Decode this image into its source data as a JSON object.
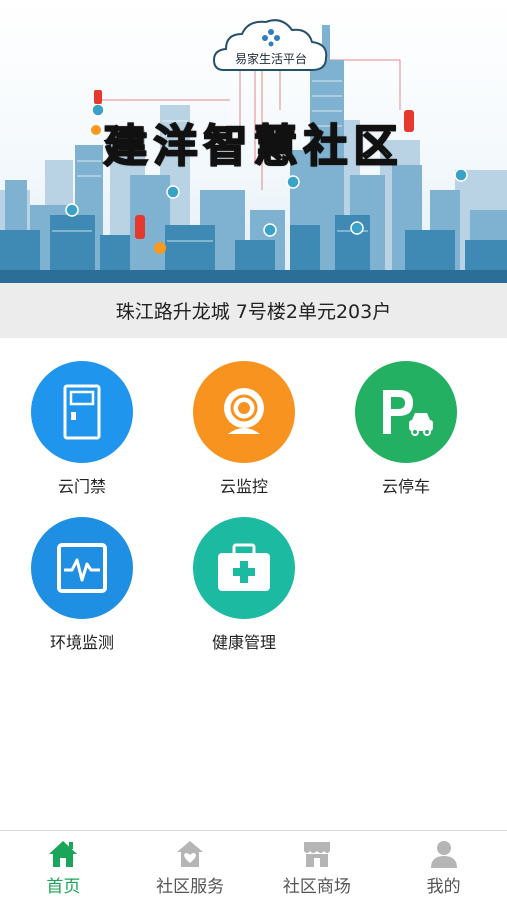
{
  "banner": {
    "cloud_label": "易家生活平台",
    "title": "建洋智慧社区"
  },
  "address": "珠江路升龙城 7号楼2单元203户",
  "services": [
    {
      "label": "云门禁",
      "icon": "door-icon",
      "color": "#1f95ee"
    },
    {
      "label": "云监控",
      "icon": "camera-icon",
      "color": "#f7931e"
    },
    {
      "label": "云停车",
      "icon": "parking-icon",
      "color": "#23b062"
    },
    {
      "label": "环境监测",
      "icon": "monitor-icon",
      "color": "#1f8fe3"
    },
    {
      "label": "健康管理",
      "icon": "medkit-icon",
      "color": "#1cbaa0"
    }
  ],
  "bottom_nav": {
    "active_color": "#1aa55a",
    "items": [
      {
        "label": "首页",
        "icon": "home-icon",
        "active": true
      },
      {
        "label": "社区服务",
        "icon": "community-service-icon",
        "active": false
      },
      {
        "label": "社区商场",
        "icon": "store-icon",
        "active": false
      },
      {
        "label": "我的",
        "icon": "user-icon",
        "active": false
      }
    ]
  }
}
